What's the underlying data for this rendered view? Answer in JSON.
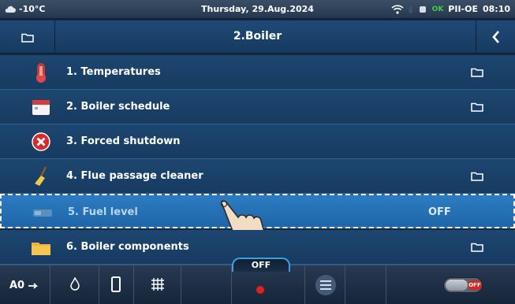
{
  "status": {
    "temperature": "-10°C",
    "date": "Thursday, 29.Aug.2024",
    "connection": "OK",
    "device": "PII-OE",
    "time": "08:10"
  },
  "header": {
    "title": "2.Boiler"
  },
  "menu": {
    "items": [
      {
        "label": "1. Temperatures",
        "icon": "thermometer-icon",
        "has_folder": true
      },
      {
        "label": "2. Boiler schedule",
        "icon": "calendar-icon",
        "has_folder": true
      },
      {
        "label": "3. Forced shutdown",
        "icon": "stop-icon",
        "has_folder": false
      },
      {
        "label": "4. Flue passage cleaner",
        "icon": "broom-icon",
        "has_folder": true
      },
      {
        "label": "5. Fuel level",
        "icon": "fuel-level-icon",
        "value": "OFF",
        "selected": true
      },
      {
        "label": "6. Boiler components",
        "icon": "folder-components-icon",
        "has_folder": true
      }
    ]
  },
  "bottom": {
    "mode_label": "OFF",
    "toggle_label": "OFF"
  },
  "colors": {
    "row_bg": "#1b426a",
    "selected_bg": "#2674ba",
    "accent": "#3aa0e6",
    "toggle_off": "#d6271f"
  }
}
